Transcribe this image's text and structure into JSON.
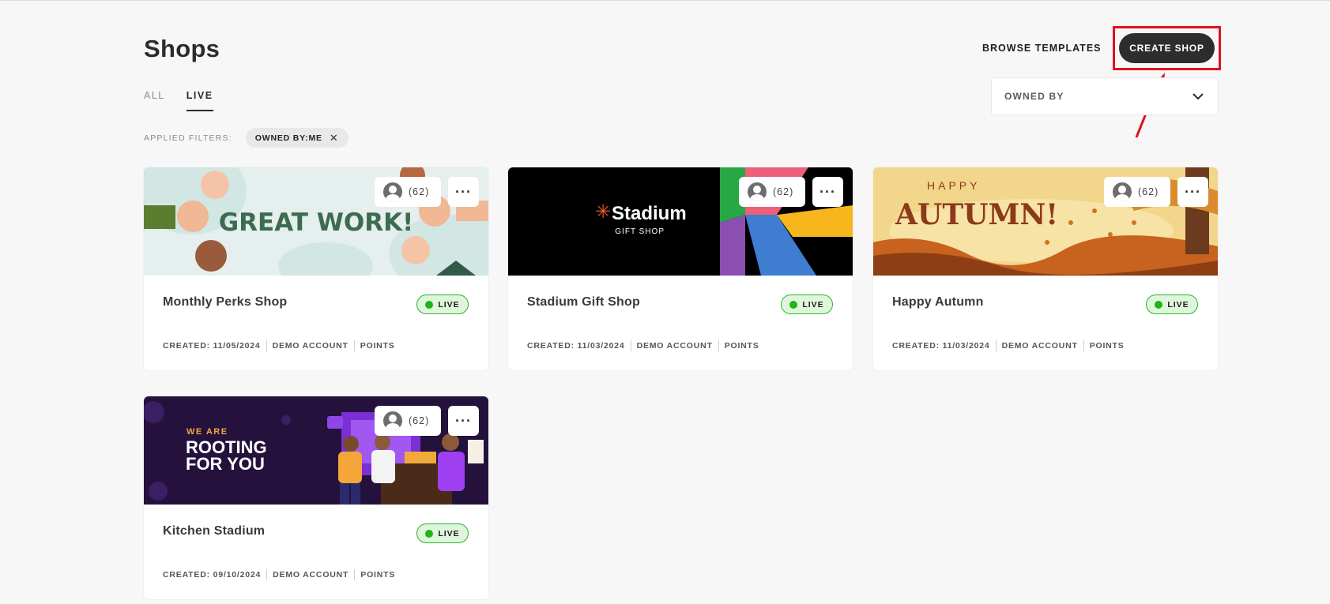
{
  "header": {
    "title": "Shops",
    "browse_label": "BROWSE TEMPLATES",
    "create_label": "CREATE SHOP"
  },
  "tabs": [
    {
      "label": "ALL",
      "active": false
    },
    {
      "label": "LIVE",
      "active": true
    }
  ],
  "owned_by": {
    "label": "OWNED BY"
  },
  "filters": {
    "label": "APPLIED FILTERS:",
    "chips": [
      {
        "label": "OWNED BY:ME"
      }
    ]
  },
  "shops": [
    {
      "name": "Monthly Perks Shop",
      "status": "LIVE",
      "created": "CREATED: 11/05/2024",
      "account": "DEMO ACCOUNT",
      "currency": "POINTS",
      "members": "(62)",
      "banner_text": "GREAT WORK!"
    },
    {
      "name": "Stadium Gift Shop",
      "status": "LIVE",
      "created": "CREATED: 11/03/2024",
      "account": "DEMO ACCOUNT",
      "currency": "POINTS",
      "members": "(62)",
      "banner_text": "Stadium",
      "banner_sub": "GIFT SHOP"
    },
    {
      "name": "Happy Autumn",
      "status": "LIVE",
      "created": "CREATED: 11/03/2024",
      "account": "DEMO ACCOUNT",
      "currency": "POINTS",
      "members": "(62)",
      "banner_text": "AUTUMN!",
      "banner_sub": "HAPPY"
    },
    {
      "name": "Kitchen Stadium",
      "status": "LIVE",
      "created": "CREATED: 09/10/2024",
      "account": "DEMO ACCOUNT",
      "currency": "POINTS",
      "members": "(62)",
      "banner_text": "ROOTING",
      "banner_text2": "FOR YOU",
      "banner_sub": "WE ARE"
    }
  ],
  "colors": {
    "accent_dark": "#2d2d2d",
    "highlight_red": "#e0101e",
    "live_green": "#1fb41a"
  }
}
